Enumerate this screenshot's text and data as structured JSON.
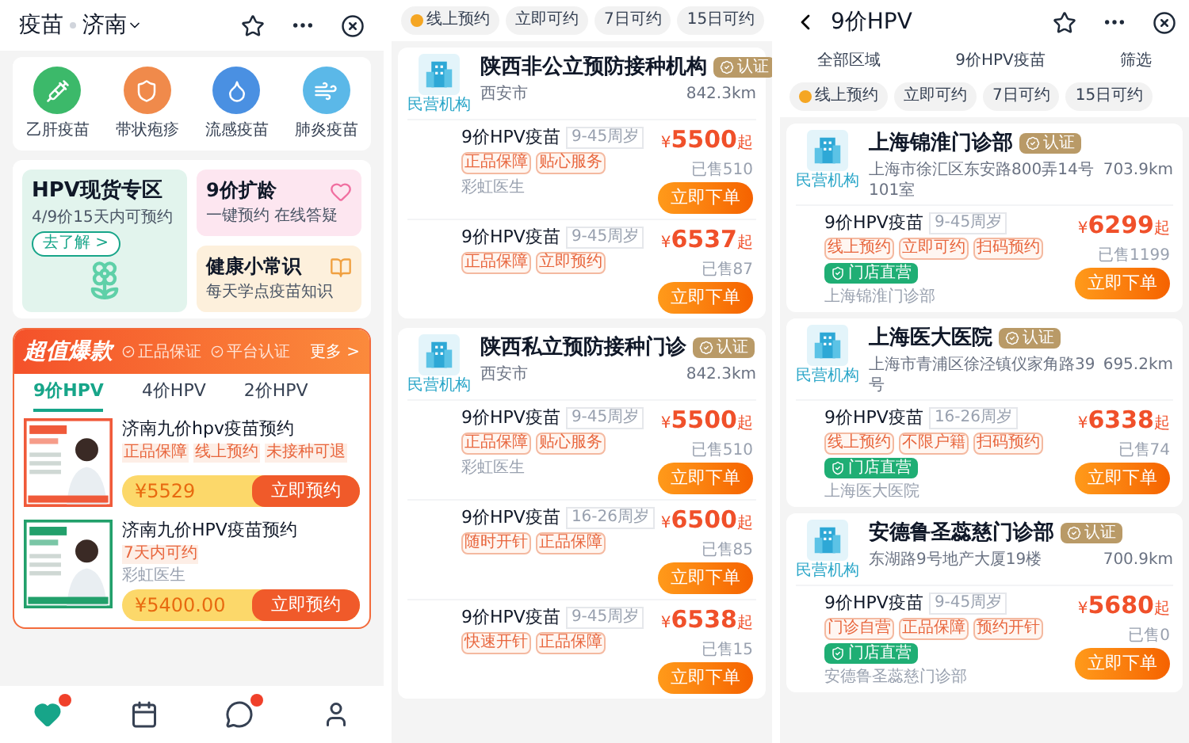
{
  "left": {
    "header": {
      "title": "疫苗",
      "city": "济南"
    },
    "categories": [
      {
        "label": "乙肝疫苗",
        "color": "#3cb96a"
      },
      {
        "label": "带状疱疹",
        "color": "#f08a4b"
      },
      {
        "label": "流感疫苗",
        "color": "#4a90e2"
      },
      {
        "label": "肺炎疫苗",
        "color": "#5bb8e8"
      }
    ],
    "promo_main": {
      "title": "HPV现货专区",
      "subtitle": "4/9价15天内可预约",
      "link": "去了解 >"
    },
    "promo_side": [
      {
        "title": "9价扩龄",
        "subtitle": "一键预约 在线答疑",
        "color": "#fde6f0"
      },
      {
        "title": "健康小常识",
        "subtitle": "每天学点疫苗知识",
        "color": "#fdf0dc"
      }
    ],
    "deals": {
      "title": "超值爆款",
      "badges": [
        "正品保证",
        "平台认证"
      ],
      "more": "更多 >",
      "tabs": [
        {
          "label": "9价HPV",
          "selected": true
        },
        {
          "label": "4价HPV",
          "selected": false
        },
        {
          "label": "2价HPV",
          "selected": false
        }
      ],
      "products": [
        {
          "title": "济南九价hpv疫苗预约",
          "tags": [
            "正品保障",
            "线上预约",
            "未接种可退"
          ],
          "price": "¥5529",
          "button": "立即预约",
          "color": "#f05a3a"
        },
        {
          "title": "济南九价HPV疫苗预约",
          "tags": [
            "7天内可约"
          ],
          "seller": "彩虹医生",
          "price": "¥5400.00",
          "button": "立即预约",
          "color": "#22a06b"
        }
      ]
    },
    "nav": [
      {
        "kind": "home",
        "selected": true,
        "badge": true
      },
      {
        "kind": "calendar",
        "selected": false,
        "badge": false
      },
      {
        "kind": "chat",
        "selected": false,
        "badge": true
      },
      {
        "kind": "profile",
        "selected": false,
        "badge": false
      }
    ]
  },
  "middle": {
    "filters": [
      {
        "label": "线上预约",
        "kind": "featured"
      },
      {
        "label": "立即可约",
        "kind": "plain"
      },
      {
        "label": "7日可约",
        "kind": "plain"
      },
      {
        "label": "15日可约",
        "kind": "plain"
      }
    ],
    "clinics": [
      {
        "name": "陕西非公立预防接种机构",
        "cert": "认证",
        "address": "西安市",
        "distance": "842.3km",
        "label": "民营机构",
        "items": [
          {
            "name": "9价HPV疫苗",
            "age": "9-45周岁",
            "tags": [
              "正品保障",
              "贴心服务"
            ],
            "seller": "彩虹医生",
            "currency": "¥",
            "price": "5500",
            "unit": "起",
            "sold": "已售510",
            "button": "立即下单"
          },
          {
            "name": "9价HPV疫苗",
            "age": "9-45周岁",
            "tags": [
              "正品保障",
              "立即预约"
            ],
            "currency": "¥",
            "price": "6537",
            "unit": "起",
            "sold": "已售87",
            "button": "立即下单"
          }
        ]
      },
      {
        "name": "陕西私立预防接种门诊",
        "cert": "认证",
        "address": "西安市",
        "distance": "842.3km",
        "label": "民营机构",
        "items": [
          {
            "name": "9价HPV疫苗",
            "age": "9-45周岁",
            "tags": [
              "正品保障",
              "贴心服务"
            ],
            "seller": "彩虹医生",
            "currency": "¥",
            "price": "5500",
            "unit": "起",
            "sold": "已售510",
            "button": "立即下单"
          },
          {
            "name": "9价HPV疫苗",
            "age": "16-26周岁",
            "tags": [
              "随时开针",
              "正品保障"
            ],
            "currency": "¥",
            "price": "6500",
            "unit": "起",
            "sold": "已售85",
            "button": "立即下单"
          },
          {
            "name": "9价HPV疫苗",
            "age": "9-45周岁",
            "tags": [
              "快速开针",
              "正品保障"
            ],
            "currency": "¥",
            "price": "6538",
            "unit": "起",
            "sold": "已售15",
            "button": "立即下单"
          }
        ]
      }
    ]
  },
  "right": {
    "header": {
      "title": "9价HPV"
    },
    "dropdowns": [
      "全部区域",
      "9价HPV疫苗",
      "筛选"
    ],
    "filters": [
      {
        "label": "线上预约",
        "kind": "featured"
      },
      {
        "label": "立即可约",
        "kind": "plain"
      },
      {
        "label": "7日可约",
        "kind": "plain"
      },
      {
        "label": "15日可约",
        "kind": "plain"
      }
    ],
    "clinics": [
      {
        "name": "上海锦淮门诊部",
        "cert": "认证",
        "address": "上海市徐汇区东安路800弄14号101室",
        "distance": "703.9km",
        "label": "民营机构",
        "items": [
          {
            "name": "9价HPV疫苗",
            "age": "9-45周岁",
            "tags": [
              "线上预约",
              "立即可约",
              "扫码预约"
            ],
            "badge": "门店直营",
            "seller": "上海锦淮门诊部",
            "currency": "¥",
            "price": "6299",
            "unit": "起",
            "sold": "已售1199",
            "button": "立即下单"
          }
        ]
      },
      {
        "name": "上海医大医院",
        "cert": "认证",
        "address": "上海市青浦区徐泾镇仪家角路39号",
        "distance": "695.2km",
        "label": "民营机构",
        "items": [
          {
            "name": "9价HPV疫苗",
            "age": "16-26周岁",
            "tags": [
              "线上预约",
              "不限户籍",
              "扫码预约"
            ],
            "badge": "门店直营",
            "seller": "上海医大医院",
            "currency": "¥",
            "price": "6338",
            "unit": "起",
            "sold": "已售74",
            "button": "立即下单"
          }
        ]
      },
      {
        "name": "安德鲁圣蕊慈门诊部",
        "cert": "认证",
        "address": "东湖路9号地产大厦19楼",
        "distance": "700.9km",
        "label": "民营机构",
        "items": [
          {
            "name": "9价HPV疫苗",
            "age": "9-45周岁",
            "tags": [
              "门诊自营",
              "正品保障",
              "预约开针"
            ],
            "badge": "门店直营",
            "seller": "安德鲁圣蕊慈门诊部",
            "currency": "¥",
            "price": "5680",
            "unit": "起",
            "sold": "已售0",
            "button": "立即下单"
          }
        ]
      }
    ]
  }
}
